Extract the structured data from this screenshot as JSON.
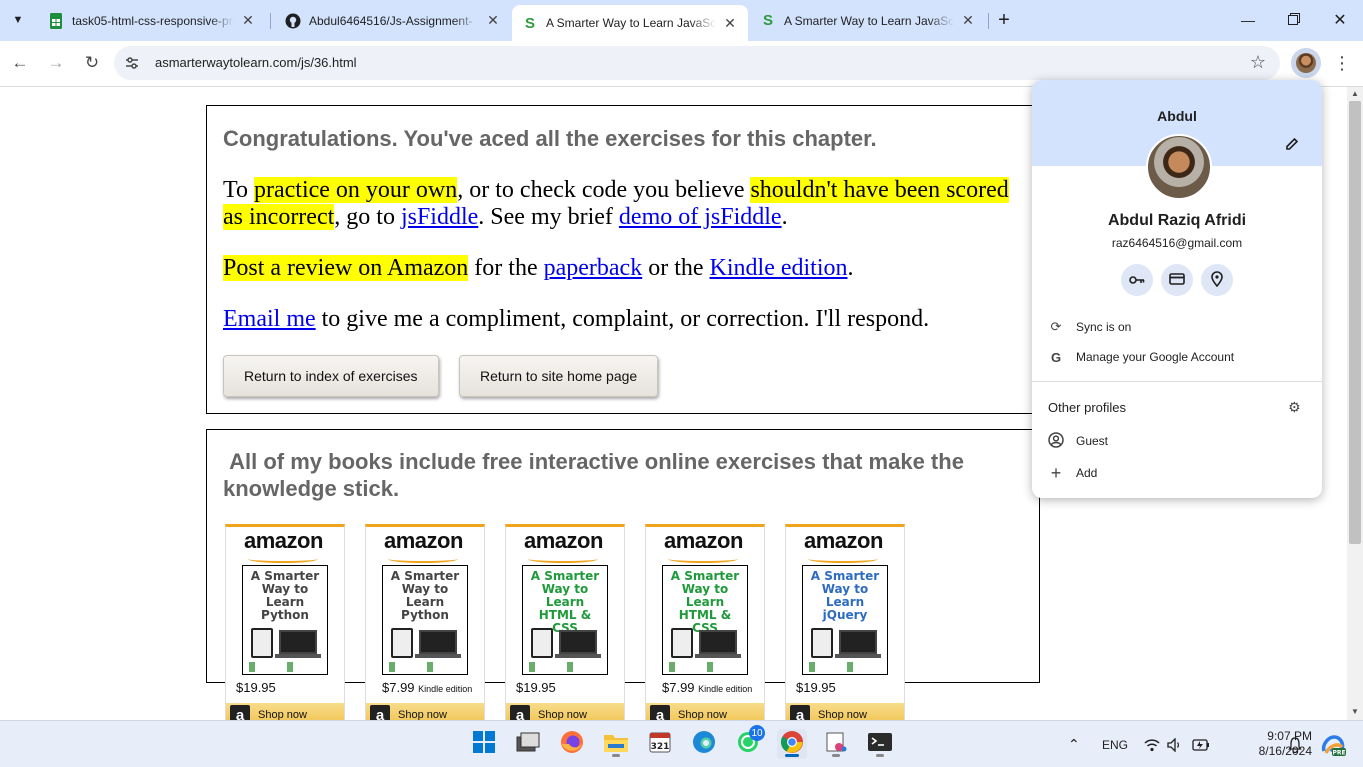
{
  "browser": {
    "tabs": [
      {
        "title": "task05-html-css-responsive-pro",
        "icon": "google-sheets-icon"
      },
      {
        "title": "Abdul6464516/Js-Assignment-",
        "icon": "github-icon"
      },
      {
        "title": "A Smarter Way to Learn JavaScr",
        "icon": "smarter-way-icon"
      },
      {
        "title": "A Smarter Way to Learn JavaScr",
        "icon": "smarter-way-icon"
      }
    ],
    "url": "asmarterwaytolearn.com/js/36.html"
  },
  "page": {
    "congrats": "Congratulations. You've aced all the exercises for this chapter.",
    "p1": {
      "t1": "To ",
      "h1": "practice on your own",
      "t2": ", or to check code you believe ",
      "h2": "shouldn't have been scored as incorrect",
      "t3": ", go to ",
      "link1": "jsFiddle",
      "t4": ". See my brief ",
      "link2": "demo of jsFiddle",
      "t5": "."
    },
    "p2": {
      "h1": "Post a review on Amazon",
      "t1": " for the ",
      "link1": "paperback",
      "t2": " or the ",
      "link2": "Kindle edition",
      "t3": "."
    },
    "p3": {
      "link1": "Email me",
      "t1": " to give me a compliment, complaint, or correction. I'll respond."
    },
    "buttons": {
      "index": "Return to index of exercises",
      "home": "Return to site home page"
    },
    "books_heading": "All of my books include free interactive online exercises that make the knowledge stick.",
    "books": [
      {
        "logo": "amazon",
        "title": "A Smarter Way to Learn Python",
        "title_color": "#444444",
        "price": "$19.95",
        "edition": "",
        "cta": "Shop now"
      },
      {
        "logo": "amazon",
        "title": "A Smarter Way to Learn Python",
        "title_color": "#444444",
        "price": "$7.99",
        "edition": "Kindle edition",
        "cta": "Shop now"
      },
      {
        "logo": "amazon",
        "title": "A Smarter Way to Learn HTML & CSS",
        "title_color": "#1e9a3a",
        "price": "$19.95",
        "edition": "",
        "cta": "Shop now"
      },
      {
        "logo": "amazon",
        "title": "A Smarter Way to Learn HTML & CSS",
        "title_color": "#1e9a3a",
        "price": "$7.99",
        "edition": "Kindle edition",
        "cta": "Shop now"
      },
      {
        "logo": "amazon",
        "title": "A Smarter Way to Learn jQuery",
        "title_color": "#2d6cc0",
        "price": "$19.95",
        "edition": "",
        "cta": "Shop now"
      }
    ]
  },
  "profile": {
    "name": "Abdul",
    "full_name": "Abdul Raziq Afridi",
    "email": "raz6464516@gmail.com",
    "sync": "Sync is on",
    "manage": "Manage your Google Account",
    "other_profiles": "Other profiles",
    "guest": "Guest",
    "add": "Add"
  },
  "taskbar": {
    "language": "ENG",
    "time": "9:07 PM",
    "date": "8/16/2024",
    "whatsapp_badge": "10"
  },
  "colors": {
    "highlight": "#ffff00",
    "link": "#0000ee",
    "tabstrip": "#d3e3fd",
    "amazon_orange": "#f0a41c"
  }
}
